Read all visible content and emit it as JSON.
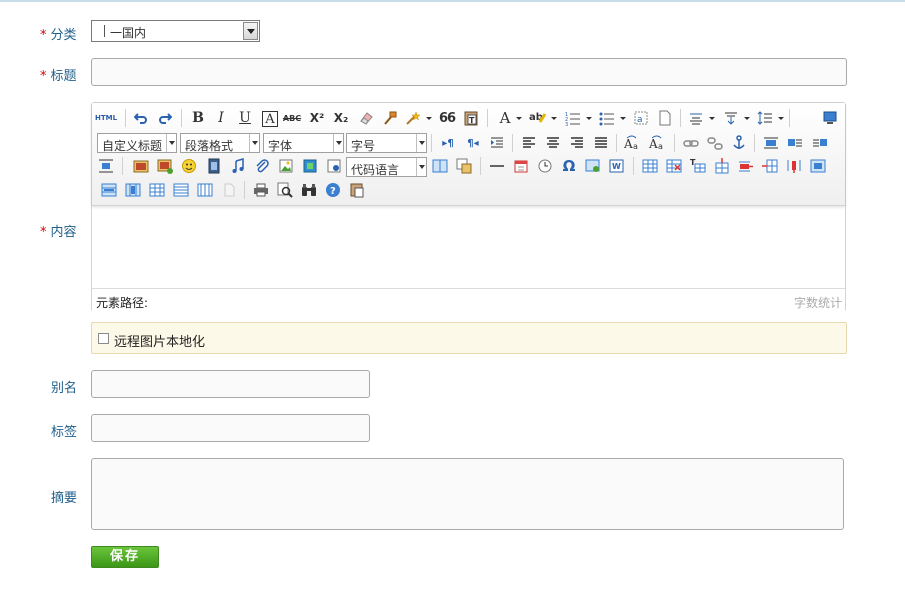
{
  "form": {
    "category": {
      "label": "分类",
      "required_mark": "*",
      "value": "一国内"
    },
    "title": {
      "label": "标题",
      "required_mark": "*",
      "value": ""
    },
    "content": {
      "label": "内容",
      "required_mark": "*"
    },
    "alias": {
      "label": "别名",
      "value": ""
    },
    "tags": {
      "label": "标签",
      "value": ""
    },
    "summary": {
      "label": "摘要",
      "value": ""
    },
    "remote_image_checkbox": {
      "label": "远程图片本地化",
      "checked": false
    },
    "save_button": {
      "label": "保存"
    }
  },
  "editor": {
    "html_label": "HTML",
    "custom_title_label": "自定义标题",
    "paragraph_format_label": "段落格式",
    "font_family_label": "字体",
    "font_size_label": "字号",
    "code_language_label": "代码语言",
    "bold_label": "B",
    "italic_label": "I",
    "underline_label": "U",
    "font_border_label": "A",
    "strikethrough_label": "ABC",
    "superscript_label": "X²",
    "subscript_label": "X₂",
    "blockquote_label": "66",
    "font_color_label": "A",
    "ltr_label": "▸¶",
    "rtl_label": "¶◂",
    "omega_label": "Ω",
    "element_path_label": "元素路径:",
    "word_count_label": "字数统计"
  },
  "colors": {
    "label_text": "#1f5f8b",
    "required": "#d40000",
    "save_button": "#4ea528",
    "remote_bg": "#fdf9e8"
  }
}
